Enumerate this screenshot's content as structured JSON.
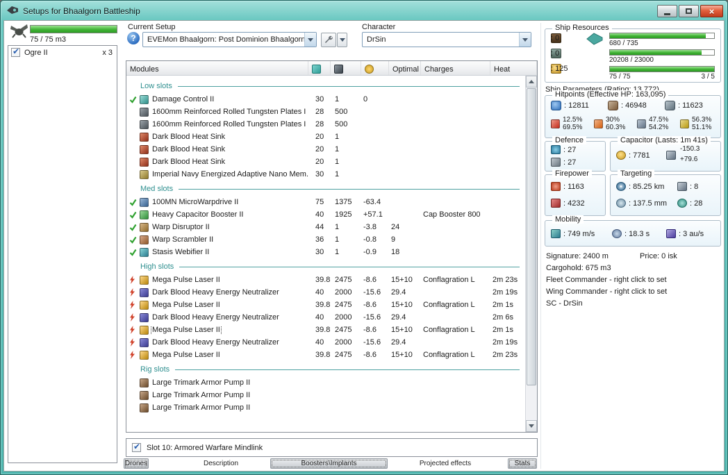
{
  "window": {
    "title": "Setups for Bhaalgorn Battleship"
  },
  "drone_bay": {
    "capacity_text": "75 / 75 m3",
    "fill_pct": 100,
    "items": [
      {
        "name": "Ogre II",
        "qty": "x 3",
        "checked": true
      }
    ]
  },
  "current_setup": {
    "label": "Current Setup",
    "value": "EVEMon Bhaalgorn: Post Dominion Bhaalgorn"
  },
  "character": {
    "label": "Character",
    "value": "DrSin"
  },
  "modules": {
    "title": "Modules",
    "columns": {
      "optimal": "Optimal",
      "charges": "Charges",
      "heat": "Heat"
    },
    "sections": [
      {
        "name": "Low slots",
        "rows": [
          {
            "status": "active",
            "icon": "damage-control",
            "name": "Damage Control II",
            "cpu": "30",
            "pg": "1",
            "cap": "0",
            "optimal": "",
            "charges": "",
            "heat": ""
          },
          {
            "status": "",
            "icon": "armor-plate",
            "name": "1600mm Reinforced Rolled Tungsten Plates I",
            "cpu": "28",
            "pg": "500",
            "cap": "",
            "optimal": "",
            "charges": "",
            "heat": ""
          },
          {
            "status": "",
            "icon": "armor-plate",
            "name": "1600mm Reinforced Rolled Tungsten Plates I",
            "cpu": "28",
            "pg": "500",
            "cap": "",
            "optimal": "",
            "charges": "",
            "heat": ""
          },
          {
            "status": "",
            "icon": "heat-sink",
            "name": "Dark Blood Heat Sink",
            "cpu": "20",
            "pg": "1",
            "cap": "",
            "optimal": "",
            "charges": "",
            "heat": ""
          },
          {
            "status": "",
            "icon": "heat-sink",
            "name": "Dark Blood Heat Sink",
            "cpu": "20",
            "pg": "1",
            "cap": "",
            "optimal": "",
            "charges": "",
            "heat": ""
          },
          {
            "status": "",
            "icon": "heat-sink",
            "name": "Dark Blood Heat Sink",
            "cpu": "20",
            "pg": "1",
            "cap": "",
            "optimal": "",
            "charges": "",
            "heat": ""
          },
          {
            "status": "",
            "icon": "nano-membrane",
            "name": "Imperial Navy Energized Adaptive Nano Mem...",
            "cpu": "30",
            "pg": "1",
            "cap": "",
            "optimal": "",
            "charges": "",
            "heat": ""
          }
        ]
      },
      {
        "name": "Med slots",
        "rows": [
          {
            "status": "active",
            "icon": "mwd",
            "name": "100MN MicroWarpdrive II",
            "cpu": "75",
            "pg": "1375",
            "cap": "-63.4",
            "optimal": "",
            "charges": "",
            "heat": ""
          },
          {
            "status": "active",
            "icon": "cap-booster",
            "name": "Heavy Capacitor Booster II",
            "cpu": "40",
            "pg": "1925",
            "cap": "+57.1",
            "optimal": "",
            "charges": "Cap Booster 800",
            "heat": ""
          },
          {
            "status": "active",
            "icon": "warp-disruptor",
            "name": "Warp Disruptor II",
            "cpu": "44",
            "pg": "1",
            "cap": "-3.8",
            "optimal": "24",
            "charges": "",
            "heat": ""
          },
          {
            "status": "active",
            "icon": "warp-scrambler",
            "name": "Warp Scrambler II",
            "cpu": "36",
            "pg": "1",
            "cap": "-0.8",
            "optimal": "9",
            "charges": "",
            "heat": ""
          },
          {
            "status": "active",
            "icon": "stasis-web",
            "name": "Stasis Webifier II",
            "cpu": "30",
            "pg": "1",
            "cap": "-0.9",
            "optimal": "18",
            "charges": "",
            "heat": ""
          }
        ]
      },
      {
        "name": "High slots",
        "rows": [
          {
            "status": "firing",
            "icon": "pulse-laser",
            "name": "Mega Pulse Laser II",
            "cpu": "39.8",
            "pg": "2475",
            "cap": "-8.6",
            "optimal": "15+10",
            "charges": "Conflagration L",
            "heat": "2m 23s"
          },
          {
            "status": "firing",
            "icon": "energy-neutralizer",
            "name": "Dark Blood Heavy Energy Neutralizer",
            "cpu": "40",
            "pg": "2000",
            "cap": "-15.6",
            "optimal": "29.4",
            "charges": "",
            "heat": "2m 19s"
          },
          {
            "status": "firing",
            "icon": "pulse-laser",
            "name": "Mega Pulse Laser II",
            "cpu": "39.8",
            "pg": "2475",
            "cap": "-8.6",
            "optimal": "15+10",
            "charges": "Conflagration L",
            "heat": "2m 1s"
          },
          {
            "status": "firing",
            "icon": "energy-neutralizer",
            "name": "Dark Blood Heavy Energy Neutralizer",
            "cpu": "40",
            "pg": "2000",
            "cap": "-15.6",
            "optimal": "29.4",
            "charges": "",
            "heat": "2m 6s"
          },
          {
            "status": "firing",
            "icon": "pulse-laser",
            "name": "Mega Pulse Laser II",
            "cpu": "39.8",
            "pg": "2475",
            "cap": "-8.6",
            "optimal": "15+10",
            "charges": "Conflagration L",
            "heat": "2m 1s",
            "focused": true
          },
          {
            "status": "firing",
            "icon": "energy-neutralizer",
            "name": "Dark Blood Heavy Energy Neutralizer",
            "cpu": "40",
            "pg": "2000",
            "cap": "-15.6",
            "optimal": "29.4",
            "charges": "",
            "heat": "2m 19s"
          },
          {
            "status": "firing",
            "icon": "pulse-laser",
            "name": "Mega Pulse Laser II",
            "cpu": "39.8",
            "pg": "2475",
            "cap": "-8.6",
            "optimal": "15+10",
            "charges": "Conflagration L",
            "heat": "2m 23s"
          }
        ]
      },
      {
        "name": "Rig slots",
        "rows": [
          {
            "status": "",
            "icon": "armor-rig",
            "name": "Large Trimark Armor Pump II",
            "cpu": "",
            "pg": "",
            "cap": "",
            "optimal": "",
            "charges": "",
            "heat": ""
          },
          {
            "status": "",
            "icon": "armor-rig",
            "name": "Large Trimark Armor Pump II",
            "cpu": "",
            "pg": "",
            "cap": "",
            "optimal": "",
            "charges": "",
            "heat": ""
          },
          {
            "status": "",
            "icon": "armor-rig",
            "name": "Large Trimark Armor Pump II",
            "cpu": "",
            "pg": "",
            "cap": "",
            "optimal": "",
            "charges": "",
            "heat": ""
          }
        ]
      }
    ]
  },
  "slot10": {
    "label": "Slot 10: Armored Warfare Mindlink",
    "checked": true
  },
  "tabs": [
    {
      "label": "Drones",
      "active": true
    },
    {
      "label": "Description",
      "active": false
    },
    {
      "label": "Boosters\\Implants",
      "active": true
    },
    {
      "label": "Projected effects",
      "active": false
    },
    {
      "label": "Stats",
      "active": true
    }
  ],
  "resources": {
    "label": "Ship Resources",
    "counters": [
      {
        "icon": "skillbook",
        "value": "0"
      },
      {
        "icon": "blueprint",
        "value": "0"
      },
      {
        "icon": "calibration",
        "value": "125"
      }
    ],
    "bars": [
      {
        "icon": "cpu",
        "caption": "680 / 735",
        "caption2": "",
        "pct": 92
      },
      {
        "icon": "powergrid",
        "caption": "20208 / 23000",
        "caption2": "",
        "pct": 88
      },
      {
        "icon": "dronebay",
        "caption": "75 / 75",
        "caption2": "3 / 5",
        "pct": 100
      }
    ]
  },
  "parameters_title": "Ship Parameters (Rating: 13,772)",
  "hitpoints": {
    "label": "Hitpoints (Effective HP: 163,095)",
    "pools": [
      {
        "icon": "shield",
        "value": "12811"
      },
      {
        "icon": "armor",
        "value": "46948"
      },
      {
        "icon": "hull",
        "value": "11623"
      }
    ],
    "resists": [
      {
        "icon": "em",
        "top": "12.5%",
        "bottom": "69.5%"
      },
      {
        "icon": "thermal",
        "top": "30%",
        "bottom": "60.3%"
      },
      {
        "icon": "kinetic",
        "top": "47.5%",
        "bottom": "54.2%"
      },
      {
        "icon": "explosive",
        "top": "56.3%",
        "bottom": "51.1%"
      }
    ]
  },
  "defence": {
    "label": "Defence",
    "rows": [
      {
        "icon": "shield-recharge",
        "value": "27"
      },
      {
        "icon": "armor-repair",
        "value": "27"
      }
    ]
  },
  "capacitor": {
    "label": "Capacitor (Lasts: 1m 41s)",
    "value": "7781",
    "delta_neg": "-150.3",
    "delta_pos": "+79.6"
  },
  "firepower": {
    "label": "Firepower",
    "rows": [
      {
        "icon": "volley",
        "value": "1163"
      },
      {
        "icon": "dps",
        "value": "4232"
      }
    ]
  },
  "targeting": {
    "label": "Targeting",
    "items": [
      {
        "icon": "optimal-range",
        "value": "85.25 km"
      },
      {
        "icon": "max-locked-targets",
        "value": "8"
      },
      {
        "icon": "scan-resolution",
        "value": "137.5 mm"
      },
      {
        "icon": "sensor-strength",
        "value": "28"
      }
    ]
  },
  "mobility": {
    "label": "Mobility",
    "rows": [
      {
        "icon": "max-velocity",
        "value": "749 m/s"
      },
      {
        "icon": "align-time",
        "value": "18.3 s"
      },
      {
        "icon": "warp-speed",
        "value": "3 au/s"
      }
    ]
  },
  "info": {
    "signature": "Signature: 2400 m",
    "price": "Price: 0 isk",
    "cargohold": "Cargohold: 675 m3",
    "fleet": "Fleet Commander - right click to set",
    "wing": "Wing Commander - right click to set",
    "sc": "SC - DrSin"
  }
}
